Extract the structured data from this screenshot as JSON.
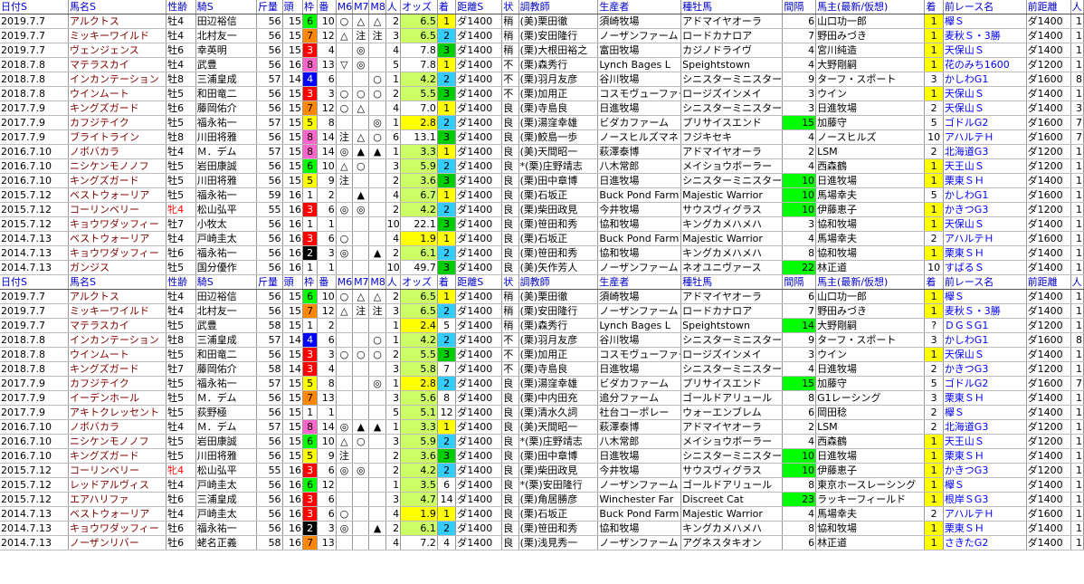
{
  "headers": [
    "日付S",
    "馬名S",
    "性齢",
    "騎S",
    "斤量",
    "頭",
    "枠",
    "番",
    "M6",
    "M7",
    "M8",
    "人",
    "オッズ",
    "着",
    "距離S",
    "状",
    "調教師",
    "生産者",
    "種牡馬",
    "間隔",
    "馬主(最新/仮想)",
    "着",
    "前レース名",
    "前距離",
    "人"
  ],
  "section1": [
    [
      "2019.7.7",
      "アルクトス",
      "牡4",
      "田辺裕信",
      "56",
      "15",
      "6",
      "10",
      "○",
      "△",
      "△",
      "2",
      "6.5",
      "1",
      "ダ1400",
      "稍",
      "(美)栗田徹",
      "須崎牧場",
      "アドマイヤオーラ",
      "6",
      "山口功一郎",
      "1",
      "欅Ｓ",
      "ダ1400",
      "1"
    ],
    [
      "2019.7.7",
      "ミッキーワイルド",
      "牡4",
      "北村友一",
      "56",
      "15",
      "7",
      "12",
      "△",
      "注",
      "注",
      "3",
      "6.5",
      "2",
      "ダ1400",
      "稍",
      "(栗)安田隆行",
      "ノーザンファーム",
      "ロードカナロア",
      "7",
      "野田みづき",
      "1",
      "麦秋Ｓ・3勝",
      "ダ1400",
      "1"
    ],
    [
      "2019.7.7",
      "ヴェンジェンス",
      "牡6",
      "幸英明",
      "56",
      "15",
      "3",
      "4",
      "",
      "◎",
      "",
      "4",
      "7.8",
      "3",
      "ダ1400",
      "稍",
      "(栗)大根田裕之",
      "富田牧場",
      "カジノドライヴ",
      "4",
      "宮川純造",
      "1",
      "天保山Ｓ",
      "ダ1400",
      "1"
    ],
    [
      "2018.7.8",
      "マテラスカイ",
      "牡4",
      "武豊",
      "56",
      "16",
      "8",
      "13",
      "▽",
      "◎",
      "",
      "5",
      "7.8",
      "1",
      "ダ1400",
      "不",
      "(栗)森秀行",
      "Lynch Bages L",
      "Speightstown",
      "4",
      "大野剛嗣",
      "1",
      "花のみち1600",
      "ダ1200",
      "1"
    ],
    [
      "2018.7.8",
      "インカンテーション",
      "牡8",
      "三浦皇成",
      "57",
      "14",
      "4",
      "6",
      "",
      "",
      "○",
      "1",
      "4.2",
      "2",
      "ダ1400",
      "不",
      "(栗)羽月友彦",
      "谷川牧場",
      "シニスターミニスター",
      "9",
      "ターフ・スポート",
      "3",
      "かしわG1",
      "ダ1600",
      "8"
    ],
    [
      "2018.7.8",
      "ウインムート",
      "牡5",
      "和田竜二",
      "56",
      "15",
      "3",
      "3",
      "○",
      "○",
      "○",
      "2",
      "5.5",
      "3",
      "ダ1400",
      "不",
      "(栗)加用正",
      "コスモヴューファーム",
      "ロージズインメイ",
      "3",
      "ウイン",
      "1",
      "天保山Ｓ",
      "ダ1400",
      "1"
    ],
    [
      "2017.7.9",
      "キングズガード",
      "牡6",
      "藤岡佑介",
      "56",
      "15",
      "7",
      "12",
      "○",
      "△",
      "",
      "4",
      "7.0",
      "1",
      "ダ1400",
      "良",
      "(栗)寺島良",
      "日進牧場",
      "シニスターミニスター",
      "3",
      "日進牧場",
      "2",
      "天保山Ｓ",
      "ダ1400",
      "3"
    ],
    [
      "2017.7.9",
      "カフジテイク",
      "牡5",
      "福永祐一",
      "57",
      "15",
      "5",
      "8",
      "",
      "",
      "◎",
      "1",
      "2.8",
      "2",
      "ダ1400",
      "良",
      "(栗)湯窪幸雄",
      "ビダカファーム",
      "プリサイスエンド",
      "15",
      "加藤守",
      "5",
      "ゴドルG2",
      "ダ1600",
      "7"
    ],
    [
      "2017.7.9",
      "ブライトライン",
      "牡8",
      "川田将雅",
      "56",
      "15",
      "8",
      "14",
      "注",
      "△",
      "○",
      "6",
      "13.1",
      "3",
      "ダ1400",
      "良",
      "(栗)鮫島一歩",
      "ノースヒルズマネ",
      "フジキセキ",
      "4",
      "ノースヒルズ",
      "10",
      "アハルテＨ",
      "ダ1600",
      "7"
    ],
    [
      "2016.7.10",
      "ノボバカラ",
      "牡4",
      "Ｍ．デム",
      "57",
      "15",
      "8",
      "14",
      "◎",
      "▲",
      "▲",
      "1",
      "3.3",
      "1",
      "ダ1400",
      "良",
      "(美)天間昭一",
      "萩澤泰博",
      "アドマイヤオーラ",
      "2",
      "LSM",
      "2",
      "北海道G3",
      "ダ1200",
      "1"
    ],
    [
      "2016.7.10",
      "ニシケンモノノフ",
      "牡5",
      "岩田康誠",
      "56",
      "15",
      "6",
      "10",
      "△",
      "○",
      "",
      "3",
      "5.9",
      "2",
      "ダ1400",
      "良",
      "*(栗)庄野靖志",
      "八木常郎",
      "メイショウボーラー",
      "4",
      "西森鶴",
      "1",
      "天王山Ｓ",
      "ダ1200",
      "1"
    ],
    [
      "2016.7.10",
      "キングズガード",
      "牡5",
      "川田将雅",
      "56",
      "15",
      "5",
      "9",
      "注",
      "",
      "",
      "2",
      "3.6",
      "3",
      "ダ1400",
      "良",
      "(栗)田中章博",
      "日進牧場",
      "シニスターミニスター",
      "10",
      "日進牧場",
      "1",
      "栗東ＳＨ",
      "ダ1400",
      "1"
    ],
    [
      "2015.7.12",
      "ベストウォーリア",
      "牡5",
      "福永祐一",
      "59",
      "16",
      "1",
      "2",
      "",
      "▲",
      "",
      "4",
      "6.7",
      "1",
      "ダ1400",
      "良",
      "(栗)石坂正",
      "Buck Pond Farm",
      "Majestic Warrior",
      "10",
      "馬場幸夫",
      "5",
      "かしわG1",
      "ダ1600",
      "1"
    ],
    [
      "2015.7.12",
      "コーリンベリー",
      "牝4",
      "松山弘平",
      "55",
      "16",
      "3",
      "6",
      "◎",
      "◎",
      "",
      "2",
      "4.2",
      "2",
      "ダ1400",
      "良",
      "(栗)柴田政見",
      "今井牧場",
      "サウスヴィグラス",
      "10",
      "伊藤恵子",
      "1",
      "かきつG3",
      "ダ1200",
      "1"
    ],
    [
      "2015.7.12",
      "キョウワダッフィー",
      "牡7",
      "小牧太",
      "56",
      "16",
      "1",
      "1",
      "",
      "",
      "",
      "10",
      "22.1",
      "3",
      "ダ1400",
      "良",
      "(栗)笹田和秀",
      "協和牧場",
      "キングカメハメハ",
      "3",
      "協和牧場",
      "1",
      "天保山Ｓ",
      "ダ1400",
      "1"
    ],
    [
      "2014.7.13",
      "ベストウォーリア",
      "牡4",
      "戸崎圭太",
      "56",
      "16",
      "3",
      "6",
      "○",
      "",
      "",
      "4",
      "1.9",
      "1",
      "ダ1400",
      "良",
      "(栗)石坂正",
      "Buck Pond Farm",
      "Majestic Warrior",
      "4",
      "馬場幸夫",
      "2",
      "アハルテＨ",
      "ダ1600",
      "1"
    ],
    [
      "2014.7.13",
      "キョウワダッフィー",
      "牡6",
      "福永祐一",
      "56",
      "16",
      "2",
      "3",
      "◎",
      "",
      "▲",
      "2",
      "6.1",
      "2",
      "ダ1400",
      "良",
      "(栗)笹田和秀",
      "協和牧場",
      "キングカメハメハ",
      "8",
      "協和牧場",
      "1",
      "栗東ＳＨ",
      "ダ1400",
      "1"
    ],
    [
      "2014.7.13",
      "ガンジス",
      "牡5",
      "国分優作",
      "56",
      "16",
      "1",
      "1",
      "",
      "",
      "",
      "10",
      "49.7",
      "3",
      "ダ1400",
      "良",
      "(美)矢作芳人",
      "ノーザンファーム",
      "ネオユニヴァース",
      "22",
      "林正道",
      "10",
      "すばるＳ",
      "ダ1400",
      "1"
    ]
  ],
  "section2": [
    [
      "2019.7.7",
      "アルクトス",
      "牡4",
      "田辺裕信",
      "56",
      "15",
      "6",
      "10",
      "○",
      "△",
      "△",
      "2",
      "6.5",
      "1",
      "ダ1400",
      "稍",
      "(美)栗田徹",
      "須崎牧場",
      "アドマイヤオーラ",
      "6",
      "山口功一郎",
      "1",
      "欅Ｓ",
      "ダ1400",
      "1"
    ],
    [
      "2019.7.7",
      "ミッキーワイルド",
      "牡4",
      "北村友一",
      "56",
      "15",
      "7",
      "12",
      "△",
      "注",
      "注",
      "3",
      "6.5",
      "2",
      "ダ1400",
      "稍",
      "(栗)安田隆行",
      "ノーザンファーム",
      "ロードカナロア",
      "7",
      "野田みづき",
      "1",
      "麦秋Ｓ・3勝",
      "ダ1400",
      "1"
    ],
    [
      "2019.7.7",
      "マテラスカイ",
      "牡5",
      "武豊",
      "58",
      "15",
      "1",
      "2",
      "",
      "",
      "",
      "1",
      "2.4",
      "5",
      "ダ1400",
      "稍",
      "(栗)森秀行",
      "Lynch Bages L",
      "Speightstown",
      "14",
      "大野剛嗣",
      "?",
      "ＤＧＳG1",
      "ダ1200",
      "1"
    ],
    [
      "2018.7.8",
      "インカンテーション",
      "牡8",
      "三浦皇成",
      "57",
      "14",
      "4",
      "6",
      "",
      "",
      "○",
      "1",
      "4.2",
      "2",
      "ダ1400",
      "不",
      "(栗)羽月友彦",
      "谷川牧場",
      "シニスターミニスター",
      "9",
      "ターフ・スポート",
      "3",
      "かしわG1",
      "ダ1600",
      "8"
    ],
    [
      "2018.7.8",
      "ウインムート",
      "牡5",
      "和田竜二",
      "56",
      "15",
      "3",
      "3",
      "○",
      "○",
      "○",
      "2",
      "5.5",
      "3",
      "ダ1400",
      "不",
      "(栗)加用正",
      "コスモヴューファーム",
      "ロージズインメイ",
      "3",
      "ウイン",
      "1",
      "天保山Ｓ",
      "ダ1400",
      "1"
    ],
    [
      "2018.7.8",
      "キングズガード",
      "牡7",
      "藤岡佑介",
      "58",
      "14",
      "3",
      "4",
      "",
      "",
      "",
      "3",
      "5.8",
      "7",
      "ダ1400",
      "不",
      "(栗)寺島良",
      "日進牧場",
      "シニスターミニスター",
      "4",
      "日進牧場",
      "2",
      "かきつG3",
      "ダ1200",
      "1"
    ],
    [
      "2017.7.9",
      "カフジテイク",
      "牡5",
      "福永祐一",
      "57",
      "15",
      "5",
      "8",
      "",
      "",
      "◎",
      "1",
      "2.8",
      "2",
      "ダ1400",
      "良",
      "(栗)湯窪幸雄",
      "ビダカファーム",
      "プリサイスエンド",
      "15",
      "加藤守",
      "5",
      "ゴドルG2",
      "ダ1600",
      "7"
    ],
    [
      "2017.7.9",
      "イーデンホール",
      "牡5",
      "Ｍ．デム",
      "56",
      "15",
      "7",
      "13",
      "",
      "",
      "",
      "3",
      "5.6",
      "8",
      "ダ1400",
      "良",
      "(栗)中内田充",
      "追分ファーム",
      "ゴールドアリュール",
      "8",
      "G1レーシング",
      "3",
      "栗東ＳＨ",
      "ダ1400",
      "1"
    ],
    [
      "2017.7.9",
      "アキトクレッセント",
      "牡5",
      "荻野極",
      "56",
      "15",
      "1",
      "1",
      "",
      "",
      "",
      "5",
      "5.1",
      "12",
      "ダ1400",
      "良",
      "(栗)清水久詞",
      "社台コーポレー",
      "ウォーエンブレム",
      "6",
      "岡田稔",
      "2",
      "欅Ｓ",
      "ダ1400",
      "1"
    ],
    [
      "2016.7.10",
      "ノボバカラ",
      "牡4",
      "Ｍ．デム",
      "57",
      "15",
      "8",
      "14",
      "◎",
      "▲",
      "▲",
      "1",
      "3.3",
      "1",
      "ダ1400",
      "良",
      "(美)天間昭一",
      "萩澤泰博",
      "アドマイヤオーラ",
      "2",
      "LSM",
      "2",
      "北海道G3",
      "ダ1200",
      "1"
    ],
    [
      "2016.7.10",
      "ニシケンモノノフ",
      "牡5",
      "岩田康誠",
      "56",
      "15",
      "6",
      "10",
      "△",
      "○",
      "",
      "3",
      "5.9",
      "2",
      "ダ1400",
      "良",
      "*(栗)庄野靖志",
      "八木常郎",
      "メイショウボーラー",
      "4",
      "西森鶴",
      "1",
      "天王山Ｓ",
      "ダ1200",
      "1"
    ],
    [
      "2016.7.10",
      "キングズガード",
      "牡5",
      "川田将雅",
      "56",
      "15",
      "5",
      "9",
      "注",
      "",
      "",
      "2",
      "3.6",
      "3",
      "ダ1400",
      "良",
      "(栗)田中章博",
      "日進牧場",
      "シニスターミニスター",
      "10",
      "日進牧場",
      "1",
      "栗東ＳＨ",
      "ダ1400",
      "1"
    ],
    [
      "2015.7.12",
      "コーリンベリー",
      "牝4",
      "松山弘平",
      "55",
      "16",
      "3",
      "6",
      "◎",
      "◎",
      "",
      "2",
      "4.2",
      "2",
      "ダ1400",
      "良",
      "(栗)柴田政見",
      "今井牧場",
      "サウスヴィグラス",
      "10",
      "伊藤恵子",
      "1",
      "かきつG3",
      "ダ1200",
      "1"
    ],
    [
      "2015.7.12",
      "レッドアルヴィス",
      "牡4",
      "戸崎圭太",
      "56",
      "16",
      "6",
      "12",
      "",
      "",
      "",
      "1",
      "3.5",
      "6",
      "ダ1400",
      "良",
      "*(栗)安田隆行",
      "ノーザンファーム",
      "ゴールドアリュール",
      "8",
      "東京ホースレーシング",
      "1",
      "欅Ｓ",
      "ダ1400",
      "1"
    ],
    [
      "2015.7.12",
      "エアハリファ",
      "牡6",
      "三浦皇成",
      "56",
      "16",
      "3",
      "6",
      "",
      "",
      "",
      "3",
      "4.7",
      "14",
      "ダ1400",
      "良",
      "(栗)角居勝彦",
      "Winchester Far",
      "Discreet Cat",
      "23",
      "ラッキーフィールド",
      "1",
      "根岸ＳG3",
      "ダ1400",
      "1"
    ],
    [
      "2014.7.13",
      "ベストウォーリア",
      "牡4",
      "戸崎圭太",
      "56",
      "16",
      "3",
      "6",
      "○",
      "",
      "",
      "4",
      "1.9",
      "1",
      "ダ1400",
      "良",
      "(栗)石坂正",
      "Buck Pond Farm",
      "Majestic Warrior",
      "4",
      "馬場幸夫",
      "2",
      "アハルテＨ",
      "ダ1600",
      "1"
    ],
    [
      "2014.7.13",
      "キョウワダッフィー",
      "牡6",
      "福永祐一",
      "56",
      "16",
      "2",
      "3",
      "◎",
      "",
      "▲",
      "2",
      "6.1",
      "2",
      "ダ1400",
      "良",
      "(栗)笹田和秀",
      "協和牧場",
      "キングカメハメハ",
      "8",
      "協和牧場",
      "1",
      "栗東ＳＨ",
      "ダ1400",
      "1"
    ],
    [
      "2014.7.13",
      "ノーザンリバー",
      "牡6",
      "蛯名正義",
      "58",
      "16",
      "7",
      "13",
      "",
      "",
      "",
      "4",
      "7.2",
      "4",
      "ダ1400",
      "良",
      "(栗)浅見秀一",
      "ノーザンファーム",
      "アグネスタキオン",
      "6",
      "林正道",
      "1",
      "さきたG2",
      "ダ1400",
      "1"
    ]
  ]
}
